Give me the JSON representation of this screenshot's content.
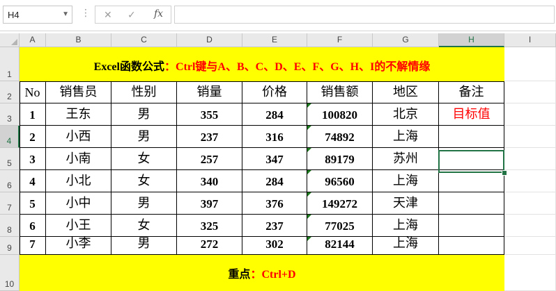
{
  "formula_bar": {
    "name_box": "H4",
    "cancel_icon": "✕",
    "enter_icon": "✓",
    "fx_label": "fx",
    "formula": ""
  },
  "columns": [
    "A",
    "B",
    "C",
    "D",
    "E",
    "F",
    "G",
    "H",
    "I"
  ],
  "rows": [
    "1",
    "2",
    "3",
    "4",
    "5",
    "6",
    "7",
    "8",
    "9",
    "10"
  ],
  "sheet": {
    "title_black_1": "Excel函数公式",
    "title_colon": "：",
    "title_red": "Ctrl键与A、B、C、D、E、F、G、H、I的不解情缘",
    "headers": [
      "No",
      "销售员",
      "性别",
      "销量",
      "价格",
      "销售额",
      "地区",
      "备注"
    ],
    "records": [
      [
        "1",
        "王东",
        "男",
        "355",
        "284",
        "100820",
        "北京",
        "目标值"
      ],
      [
        "2",
        "小西",
        "男",
        "237",
        "316",
        "74892",
        "上海",
        ""
      ],
      [
        "3",
        "小南",
        "女",
        "257",
        "347",
        "89179",
        "苏州",
        ""
      ],
      [
        "4",
        "小北",
        "女",
        "340",
        "284",
        "96560",
        "上海",
        ""
      ],
      [
        "5",
        "小中",
        "男",
        "397",
        "376",
        "149272",
        "天津",
        ""
      ],
      [
        "6",
        "小王",
        "女",
        "325",
        "237",
        "77025",
        "上海",
        ""
      ],
      [
        "7",
        "小李",
        "男",
        "272",
        "302",
        "82144",
        "上海",
        ""
      ]
    ],
    "footer_black": "重点",
    "footer_colon": "：",
    "footer_red": "Ctrl+D"
  },
  "colors": {
    "highlight": "#ffff00",
    "accent_red": "#ff0000",
    "selection": "#217346"
  }
}
